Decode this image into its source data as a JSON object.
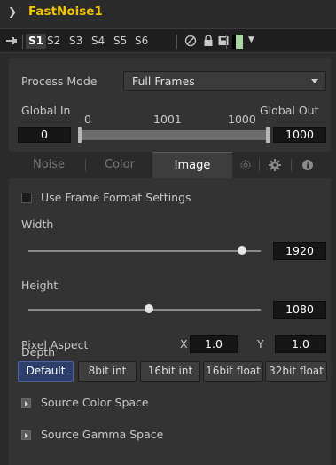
{
  "header": {
    "title": "FastNoise1"
  },
  "toolbar": {
    "slots": [
      "S1",
      "S2",
      "S3",
      "S4",
      "S5",
      "S6"
    ],
    "swatch_color": "#a9d6a3"
  },
  "process_mode": {
    "label": "Process Mode",
    "value": "Full Frames"
  },
  "global_range": {
    "in_label": "Global In",
    "out_label": "Global Out",
    "scale_min": "0",
    "scale_mid": "1001",
    "scale_max": "1000",
    "in_value": "0",
    "out_value": "1000"
  },
  "tabs": [
    "Noise",
    "Color",
    "Image"
  ],
  "active_tab": "Image",
  "use_frame_format": {
    "label": "Use Frame Format Settings",
    "checked": false
  },
  "width": {
    "label": "Width",
    "value": "1920",
    "slider_fraction": 0.92
  },
  "height": {
    "label": "Height",
    "value": "1080",
    "slider_fraction": 0.52
  },
  "pixel_aspect": {
    "label": "Pixel Aspect",
    "x_label": "X",
    "x_value": "1.0",
    "y_label": "Y",
    "y_value": "1.0"
  },
  "depth": {
    "label": "Depth",
    "options": [
      "Default",
      "8bit int",
      "16bit int",
      "16bit float",
      "32bit float"
    ],
    "selected": "Default"
  },
  "sections": [
    "Source Color Space",
    "Source Gamma Space"
  ]
}
